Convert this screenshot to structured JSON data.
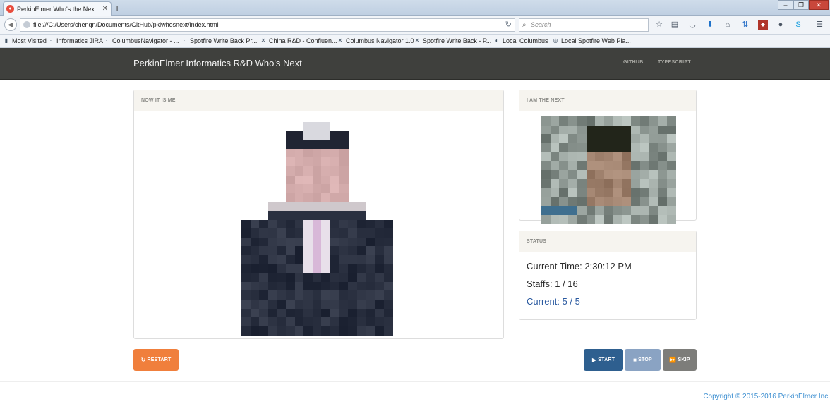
{
  "browser": {
    "tab_title": "PerkinElmer Who's the Nex...",
    "url": "file:///C:/Users/chenqn/Documents/GitHub/pkiwhosnext/index.html",
    "search_placeholder": "Search",
    "bookmarks": [
      "Most Visited",
      "Informatics JIRA",
      "ColumbusNavigator - ...",
      "Spotfire Write Back Pr...",
      "China R&D - Confluen...",
      "Columbus Navigator 1.0",
      "Spotfire Write Back - P...",
      "Local Columbus",
      "Local Spotfire Web Pla..."
    ]
  },
  "app": {
    "brand": "PerkinElmer Informatics R&D Who's Next",
    "nav_links": [
      "GITHUB",
      "TYPESCRIPT"
    ]
  },
  "panels": {
    "current_heading": "NOW IT IS ME",
    "next_heading": "I AM THE NEXT",
    "status_heading": "STATUS"
  },
  "status": {
    "current_time": "Current Time: 2:30:12 PM",
    "staffs": "Staffs: 1 / 16",
    "current": "Current: 5 / 5"
  },
  "buttons": {
    "restart": "RESTART",
    "start": "START",
    "stop": "STOP",
    "skip": "SKIP"
  },
  "colors": {
    "restart": "#f07f3c",
    "start": "#2e5f8f",
    "stop": "#8aa3c3",
    "skip": "#7d7d7a",
    "navbar": "#3f403d",
    "link_blue": "#3d8fd1"
  },
  "footer": {
    "copyright": "Copyright © 2015-2016 PerkinElmer Inc."
  }
}
